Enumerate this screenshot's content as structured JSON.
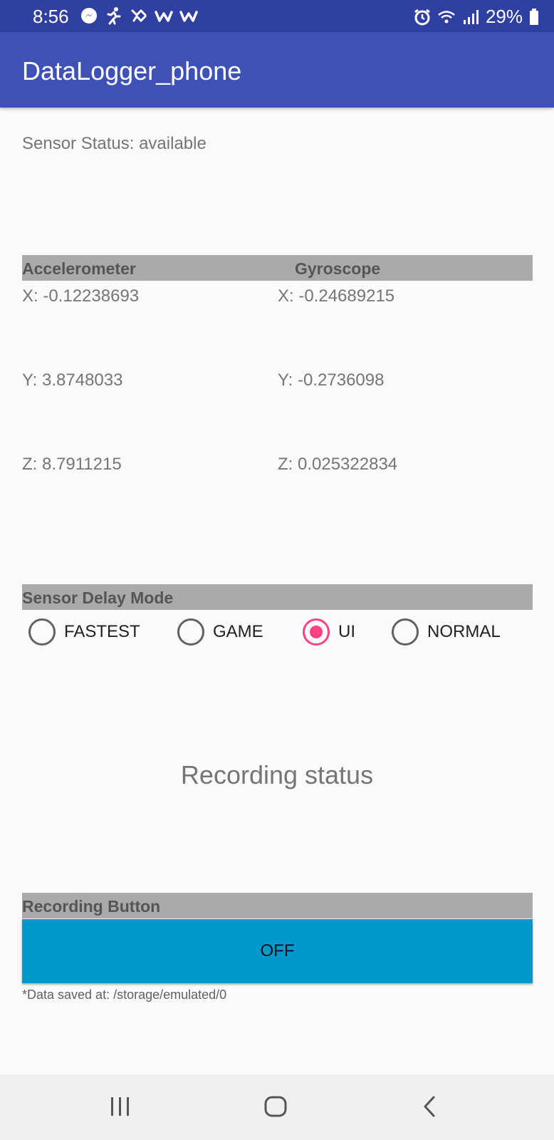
{
  "status_bar": {
    "time": "8:56",
    "battery": "29%",
    "notification_icons": [
      "messenger-icon",
      "running-icon",
      "activity-icon",
      "w-icon",
      "w-icon"
    ],
    "system_icons": [
      "alarm-icon",
      "wifi-icon",
      "signal-icon",
      "battery-icon"
    ]
  },
  "app_bar": {
    "title": "DataLogger_phone",
    "color": "#3f51b5"
  },
  "sensor_status": "Sensor Status: available",
  "sensors": {
    "accelerometer_label": "Accelerometer",
    "gyroscope_label": "Gyroscope",
    "accel": {
      "x": "X: -0.12238693",
      "y": "Y: 3.8748033",
      "z": "Z: 8.7911215"
    },
    "gyro": {
      "x": "X: -0.24689215",
      "y": "Y: -0.2736098",
      "z": "Z: 0.025322834"
    }
  },
  "delay_mode": {
    "label": "Sensor Delay Mode",
    "options": [
      {
        "label": "FASTEST",
        "checked": false
      },
      {
        "label": "GAME",
        "checked": false
      },
      {
        "label": "UI",
        "checked": true
      },
      {
        "label": "NORMAL",
        "checked": false
      }
    ]
  },
  "recording": {
    "status_text": "Recording status",
    "button_section_label": "Recording Button",
    "button_label": "OFF",
    "button_color": "#0099cc",
    "saved_note": "*Data saved at: /storage/emulated/0"
  },
  "nav_bar": {
    "icons": [
      "recent-apps-icon",
      "home-icon",
      "back-icon"
    ]
  }
}
